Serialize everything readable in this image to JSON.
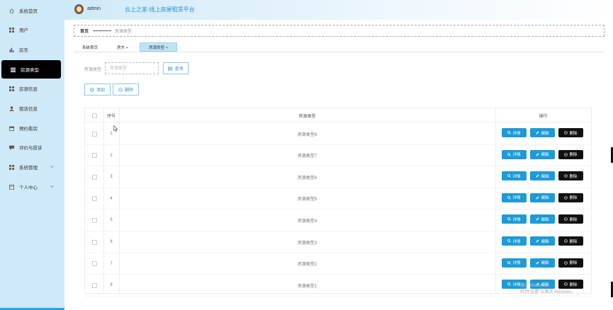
{
  "sidebar": {
    "items": [
      {
        "label": "系统首页",
        "icon": "home-icon"
      },
      {
        "label": "用户",
        "icon": "grid-icon"
      },
      {
        "label": "房东",
        "icon": "bar-chart-icon"
      },
      {
        "label": "房源类型",
        "icon": "list-icon",
        "active": true
      },
      {
        "label": "房源信息",
        "icon": "grid-icon"
      },
      {
        "label": "租赁信息",
        "icon": "user-icon"
      },
      {
        "label": "预约看房",
        "icon": "calendar-icon"
      },
      {
        "label": "评价与投诉",
        "icon": "comment-icon"
      },
      {
        "label": "系统管理",
        "icon": "grid-icon",
        "expandable": true
      },
      {
        "label": "个人中心",
        "icon": "window-icon",
        "expandable": true
      }
    ]
  },
  "header": {
    "username": "admin",
    "title": "云上之家-线上房屋租赁平台"
  },
  "breadcrumb": {
    "home": "首页",
    "current": "房源类型"
  },
  "tabs": [
    {
      "label": "系统首页"
    },
    {
      "label": "房东 ×"
    },
    {
      "label": "房源类型 ×",
      "active": true
    }
  ],
  "search": {
    "label": "房源类型",
    "placeholder": "房源类型",
    "button": "查询"
  },
  "toolbar": {
    "add": "添加",
    "delete": "删除"
  },
  "table": {
    "headers": {
      "index": "序号",
      "type": "房源类型",
      "actions": "操作"
    },
    "rows": [
      {
        "index": "1",
        "type": "房源类型8"
      },
      {
        "index": "2",
        "type": "房源类型7"
      },
      {
        "index": "3",
        "type": "房源类型6"
      },
      {
        "index": "4",
        "type": "房源类型5"
      },
      {
        "index": "5",
        "type": "房源类型4"
      },
      {
        "index": "6",
        "type": "房源类型3"
      },
      {
        "index": "7",
        "type": "房源类型2"
      },
      {
        "index": "8",
        "type": "房源类型1"
      }
    ],
    "actions": {
      "detail": "详情",
      "edit": "编辑",
      "delete": "删除"
    }
  },
  "watermark": {
    "line1": "激活 Windows",
    "line2": "转到\"设置\"以激活 Windows。"
  },
  "colors": {
    "sidebar_bg": "#cfe9f8",
    "active_item": "#000000",
    "primary": "#1e9ad6",
    "danger_btn": "#111111",
    "title": "#2a8fd0"
  }
}
